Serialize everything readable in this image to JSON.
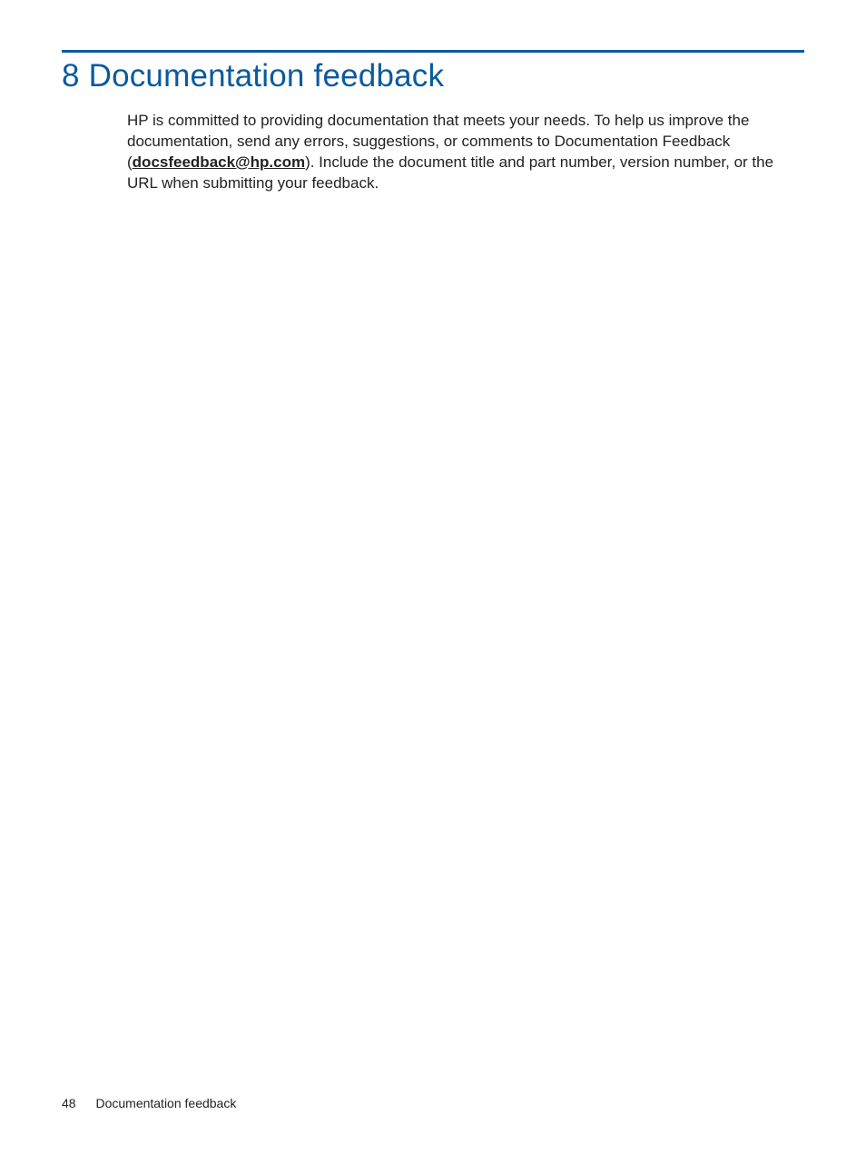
{
  "header": {
    "title": "8 Documentation feedback"
  },
  "body": {
    "part1": "HP is committed to providing documentation that meets your needs. To help us improve the documentation, send any errors, suggestions, or comments to Documentation Feedback (",
    "email": "docsfeedback@hp.com",
    "part2": "). Include the document title and part number, version number, or the URL when submitting your feedback."
  },
  "footer": {
    "page_number": "48",
    "section": "Documentation feedback"
  }
}
